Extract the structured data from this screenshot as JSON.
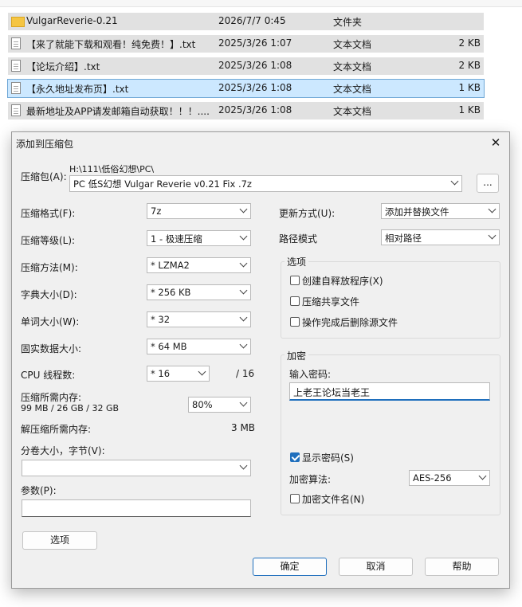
{
  "file_list": {
    "rows": [
      {
        "icon": "folder-icon",
        "name": "VulgarReverie-0.21",
        "date": "2026/7/7 0:45",
        "type": "文件夹",
        "size": "",
        "selected": false
      },
      {
        "icon": "text-file-icon",
        "name": "【来了就能下载和观看！纯免费！】.txt",
        "date": "2025/3/26 1:07",
        "type": "文本文档",
        "size": "2 KB",
        "selected": false
      },
      {
        "icon": "text-file-icon",
        "name": "【论坛介绍】.txt",
        "date": "2025/3/26 1:08",
        "type": "文本文档",
        "size": "2 KB",
        "selected": false
      },
      {
        "icon": "text-file-icon",
        "name": "【永久地址发布页】.txt",
        "date": "2025/3/26 1:08",
        "type": "文本文档",
        "size": "1 KB",
        "selected": true
      },
      {
        "icon": "text-file-icon",
        "name": "最新地址及APP请发邮箱自动获取！！！....",
        "date": "2025/3/26 1:08",
        "type": "文本文档",
        "size": "1 KB",
        "selected": false
      }
    ]
  },
  "dialog": {
    "title": "添加到压缩包",
    "close_icon": "close-icon",
    "archive_label": "压缩包(A):",
    "archive_path": "H:\\111\\低俗幻想\\PC\\",
    "archive_name": "PC 低S幻想 Vulgar Reverie v0.21 Fix .7z",
    "browse_label": "...",
    "format_label": "压缩格式(F):",
    "format_value": "7z",
    "level_label": "压缩等级(L):",
    "level_value": "1 - 极速压缩",
    "method_label": "压缩方法(M):",
    "method_value": "* LZMA2",
    "dict_label": "字典大小(D):",
    "dict_value": "* 256 KB",
    "word_label": "单词大小(W):",
    "word_value": "* 32",
    "solid_label": "固实数据大小:",
    "solid_value": "* 64 MB",
    "cpu_label": "CPU 线程数:",
    "cpu_value": "* 16",
    "cpu_total": "/ 16",
    "mem_label": "压缩所需内存:",
    "mem_value": "99 MB / 26 GB / 32 GB",
    "mem_percent": "80%",
    "decomp_label": "解压缩所需内存:",
    "decomp_value": "3 MB",
    "split_label": "分卷大小，字节(V):",
    "split_value": "",
    "params_label": "参数(P):",
    "params_value": "",
    "options_button": "选项",
    "update_label": "更新方式(U):",
    "update_value": "添加并替换文件",
    "path_label": "路径模式",
    "path_value": "相对路径",
    "options_group": {
      "title": "选项",
      "items": [
        {
          "label": "创建自释放程序(X)",
          "checked": false
        },
        {
          "label": "压缩共享文件",
          "checked": false
        },
        {
          "label": "操作完成后删除源文件",
          "checked": false
        }
      ]
    },
    "encrypt_group": {
      "title": "加密",
      "password_label": "输入密码:",
      "password_value": "上老王论坛当老王",
      "show_password_label": "显示密码(S)",
      "show_password_checked": true,
      "method_label": "加密算法:",
      "method_value": "AES-256",
      "encrypt_names_label": "加密文件名(N)",
      "encrypt_names_checked": false
    },
    "ok_button": "确定",
    "cancel_button": "取消",
    "help_button": "帮助"
  }
}
